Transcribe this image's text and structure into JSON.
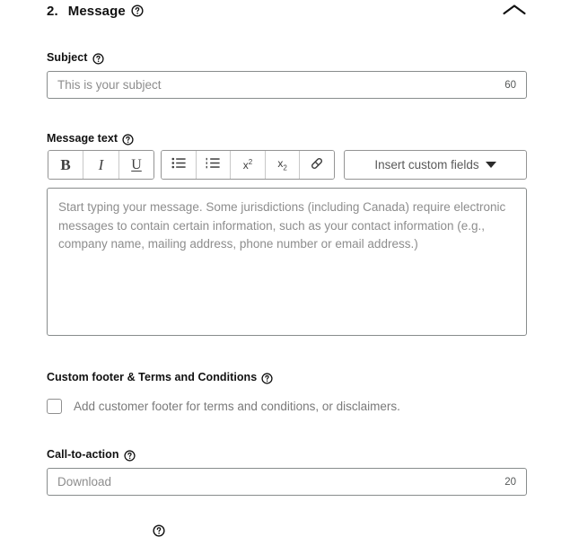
{
  "section": {
    "number": "2.",
    "title": "Message",
    "help_icon": "help-circle-icon",
    "collapse_icon": "chevron-up-icon",
    "expanded": true
  },
  "subject": {
    "label": "Subject",
    "help_icon": "help-circle-icon",
    "value": "",
    "placeholder": "This is your subject",
    "char_limit": "60"
  },
  "message_text": {
    "label": "Message text",
    "help_icon": "help-circle-icon",
    "value": "",
    "placeholder": "Start typing your message. Some jurisdictions (including Canada) require electronic messages to contain certain information, such as your contact information (e.g., company name, mailing address, phone number or email address.)",
    "toolbar": {
      "group_one": [
        {
          "name": "bold-button",
          "label": "B",
          "icon": "bold-icon"
        },
        {
          "name": "italic-button",
          "label": "I",
          "icon": "italic-icon"
        },
        {
          "name": "underline-button",
          "label": "U",
          "icon": "underline-icon"
        }
      ],
      "group_two": [
        {
          "name": "bulleted-list-button",
          "label": "",
          "icon": "bulleted-list-icon"
        },
        {
          "name": "numbered-list-button",
          "label": "",
          "icon": "numbered-list-icon"
        },
        {
          "name": "superscript-button",
          "label": "x2",
          "icon": "superscript-icon"
        },
        {
          "name": "subscript-button",
          "label": "x2",
          "icon": "subscript-icon"
        },
        {
          "name": "link-button",
          "label": "",
          "icon": "link-icon"
        }
      ],
      "insert_custom_fields": {
        "label": "Insert custom fields",
        "caret_icon": "caret-down-icon"
      }
    }
  },
  "custom_footer": {
    "label": "Custom footer & Terms and Conditions",
    "help_icon": "help-circle-icon",
    "checkbox_label": "Add customer footer for terms and conditions, or disclaimers.",
    "checked": false
  },
  "call_to_action": {
    "label": "Call-to-action",
    "help_icon": "help-circle-icon",
    "value": "",
    "placeholder": "Download",
    "char_limit": "20"
  },
  "colors": {
    "text": "#111111",
    "placeholder": "#8d8d8d",
    "border": "#888c8c",
    "toolbar_border": "#949494",
    "muted": "#7a7a7a",
    "background": "#ffffff"
  }
}
